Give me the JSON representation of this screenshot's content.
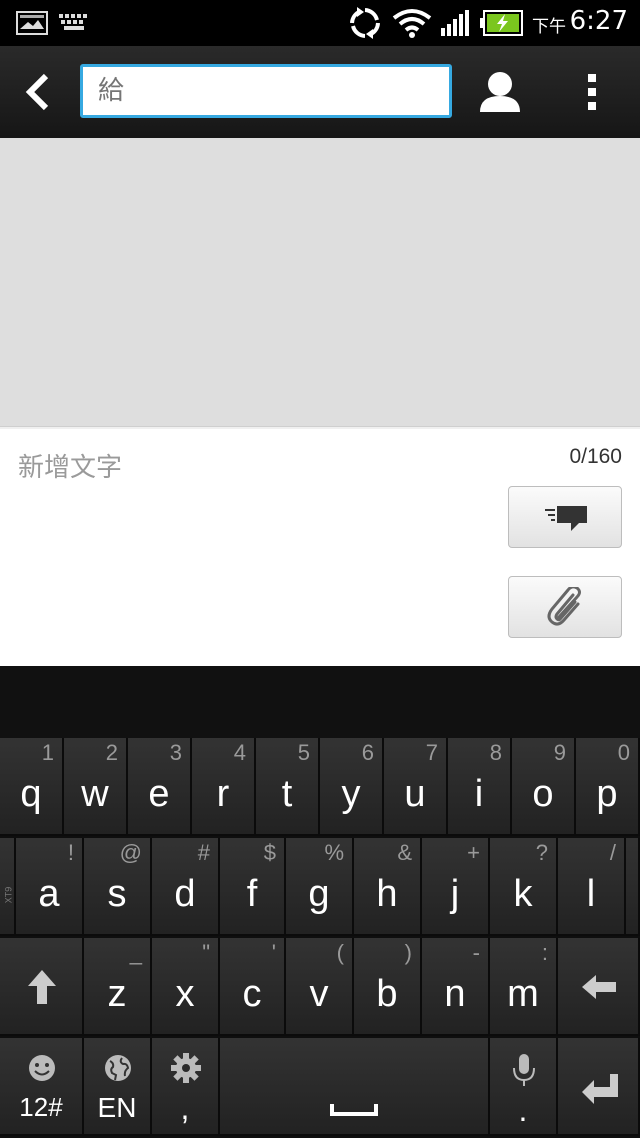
{
  "status_bar": {
    "ampm": "下午",
    "time": "6:27",
    "icons": [
      "gallery-icon",
      "keyboard-icon",
      "sync-icon",
      "wifi-icon",
      "signal-icon",
      "battery-charging-icon"
    ]
  },
  "action_bar": {
    "to_placeholder": "給",
    "icons": [
      "back-arrow-icon",
      "person-icon",
      "overflow-menu-icon"
    ]
  },
  "compose": {
    "placeholder": "新增文字",
    "counter": "0/160",
    "send_icon": "send-message-icon",
    "attach_icon": "paperclip-icon"
  },
  "keyboard": {
    "row1": [
      {
        "main": "q",
        "alt": "1"
      },
      {
        "main": "w",
        "alt": "2"
      },
      {
        "main": "e",
        "alt": "3"
      },
      {
        "main": "r",
        "alt": "4"
      },
      {
        "main": "t",
        "alt": "5"
      },
      {
        "main": "y",
        "alt": "6"
      },
      {
        "main": "u",
        "alt": "7"
      },
      {
        "main": "i",
        "alt": "8"
      },
      {
        "main": "o",
        "alt": "9"
      },
      {
        "main": "p",
        "alt": "0"
      }
    ],
    "row2_label": "XT9",
    "row2": [
      {
        "main": "a",
        "alt": "!"
      },
      {
        "main": "s",
        "alt": "@"
      },
      {
        "main": "d",
        "alt": "#"
      },
      {
        "main": "f",
        "alt": "$"
      },
      {
        "main": "g",
        "alt": "%"
      },
      {
        "main": "h",
        "alt": "&"
      },
      {
        "main": "j",
        "alt": "+"
      },
      {
        "main": "k",
        "alt": "?"
      },
      {
        "main": "l",
        "alt": "/"
      }
    ],
    "row3": [
      {
        "main": "z",
        "alt": "_"
      },
      {
        "main": "x",
        "alt": "\""
      },
      {
        "main": "c",
        "alt": "'"
      },
      {
        "main": "v",
        "alt": "("
      },
      {
        "main": "b",
        "alt": ")"
      },
      {
        "main": "n",
        "alt": "-"
      },
      {
        "main": "m",
        "alt": ":"
      }
    ],
    "row4": {
      "symbols": "12#",
      "language": "EN",
      "comma": ",",
      "period": "."
    }
  }
}
